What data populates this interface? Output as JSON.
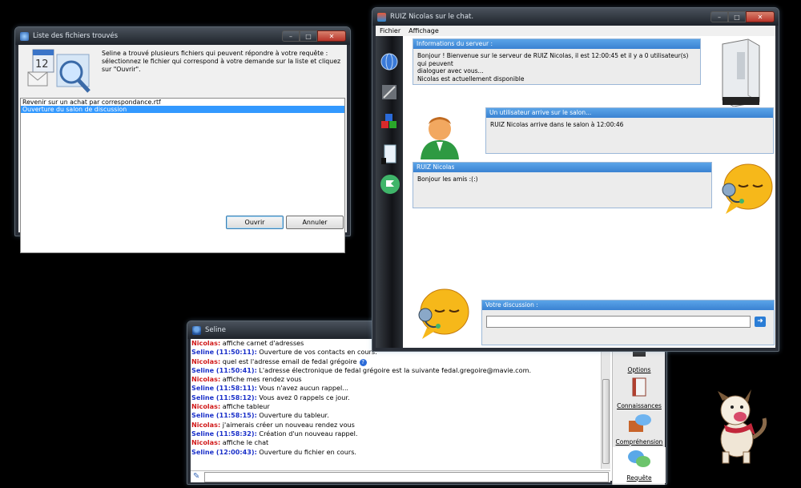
{
  "file_list_window": {
    "title": "Liste des fichiers trouvés",
    "message": "Seline a trouvé plusieurs fichiers qui peuvent répondre à votre requête : sélectionnez le fichier qui correspond à votre demande sur la liste et cliquez sur \"Ouvrir\".",
    "files": [
      {
        "label": "Revenir sur un achat par correspondance.rtf",
        "selected": false
      },
      {
        "label": "Ouverture du salon de discussion",
        "selected": true
      }
    ],
    "open_button": "Ouvrir",
    "cancel_button": "Annuler"
  },
  "chat_window": {
    "title": "RUIZ Nicolas sur le chat.",
    "menu": [
      "Fichier",
      "Affichage"
    ],
    "server_panel": {
      "header": "Informations du serveur :",
      "lines": [
        "Bonjour ! Bienvenue sur le serveur de RUIZ Nicolas, il est 12:00:45 et il y a 0 utilisateur(s) qui peuvent",
        "dialoguer avec vous...",
        "Nicolas est actuellement disponible"
      ]
    },
    "arrival_panel": {
      "header": "Un utilisateur arrive sur le salon...",
      "text": "RUIZ Nicolas arrive dans le salon à 12:00:46"
    },
    "message_panel": {
      "header": "RUIZ Nicolas",
      "text": "Bonjour les amis :(:)"
    },
    "discussion_panel": {
      "header": "Votre discussion :",
      "input_value": ""
    }
  },
  "seline_window": {
    "title": "Seline",
    "log": [
      {
        "who": "Nicolas:",
        "kind": "n",
        "text": "affiche carnet d'adresses"
      },
      {
        "who": "Seline (11:50:11):",
        "kind": "s",
        "text": "Ouverture de vos contacts en cours."
      },
      {
        "who": "Nicolas:",
        "kind": "n",
        "text": "quel est l'adresse email de fedal grégoire"
      },
      {
        "who": "Seline (11:50:41):",
        "kind": "s",
        "text": "L'adresse électronique de fedal grégoire est la suivante fedal.gregoire@mavie.com."
      },
      {
        "who": "Nicolas:",
        "kind": "n",
        "text": "affiche mes rendez vous"
      },
      {
        "who": "Seline (11:58:11):",
        "kind": "s",
        "text": "Vous n'avez aucun rappel..."
      },
      {
        "who": "Seline (11:58:12):",
        "kind": "s",
        "text": "Vous avez 0 rappels ce jour."
      },
      {
        "who": "Nicolas:",
        "kind": "n",
        "text": "affiche tableur"
      },
      {
        "who": "Seline (11:58:15):",
        "kind": "s",
        "text": "Ouverture du tableur."
      },
      {
        "who": "Nicolas:",
        "kind": "n",
        "text": "j'aimerais créer un nouveau rendez vous"
      },
      {
        "who": "Seline (11:58:32):",
        "kind": "s",
        "text": "Création d'un nouveau rappel."
      },
      {
        "who": "Nicolas:",
        "kind": "n",
        "text": "affiche le chat"
      },
      {
        "who": "Seline (12:00:43):",
        "kind": "s",
        "text": "Ouverture du fichier en cours."
      }
    ],
    "tabs": [
      "Options",
      "Connaissances",
      "Compréhension",
      "Requête"
    ],
    "input_value": ""
  },
  "colors": {
    "accent": "#3a82d2",
    "nicolas": "#d11a1a",
    "seline": "#1a30c9",
    "selection": "#3399ff"
  }
}
